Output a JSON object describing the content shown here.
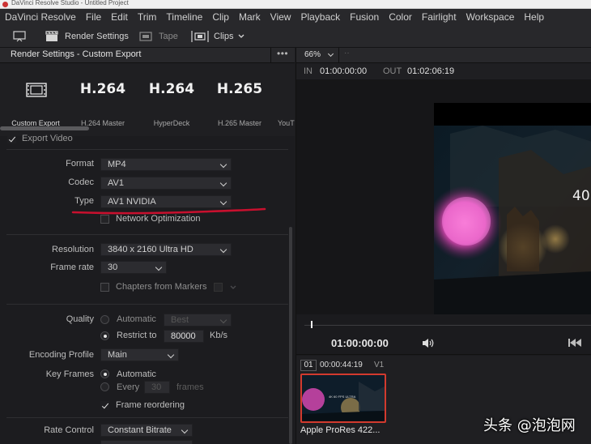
{
  "window": {
    "title": "DaVinci Resolve Studio - Untitled Project"
  },
  "menu": [
    "DaVinci Resolve",
    "File",
    "Edit",
    "Trim",
    "Timeline",
    "Clip",
    "Mark",
    "View",
    "Playback",
    "Fusion",
    "Color",
    "Fairlight",
    "Workspace",
    "Help"
  ],
  "toolbar": {
    "render_settings": "Render Settings",
    "tape": "Tape",
    "clips": "Clips"
  },
  "render_panel": {
    "title": "Render Settings - Custom Export",
    "more": "•••",
    "presets": [
      {
        "big": "",
        "sub": "Custom Export"
      },
      {
        "big": "H.264",
        "sub": "H.264 Master"
      },
      {
        "big": "H.264",
        "sub": "HyperDeck"
      },
      {
        "big": "H.265",
        "sub": "H.265 Master"
      },
      {
        "big": "",
        "sub": "YouT"
      }
    ],
    "export_video": "Export Video",
    "format": {
      "label": "Format",
      "value": "MP4"
    },
    "codec": {
      "label": "Codec",
      "value": "AV1"
    },
    "type": {
      "label": "Type",
      "value": "AV1 NVIDIA"
    },
    "network_optimization": "Network Optimization",
    "resolution": {
      "label": "Resolution",
      "value": "3840 x 2160 Ultra HD"
    },
    "frame_rate": {
      "label": "Frame rate",
      "value": "30"
    },
    "chapters_from_markers": "Chapters from Markers",
    "quality": {
      "label": "Quality",
      "automatic": "Automatic",
      "best": "Best",
      "restrict_to": "Restrict to",
      "value": "80000",
      "unit": "Kb/s"
    },
    "encoding_profile": {
      "label": "Encoding Profile",
      "value": "Main"
    },
    "key_frames": {
      "label": "Key Frames",
      "automatic": "Automatic",
      "every": "Every",
      "value": "30",
      "unit": "frames"
    },
    "frame_reordering": "Frame reordering",
    "rate_control": {
      "label": "Rate Control",
      "value": "Constant Bitrate"
    }
  },
  "viewer": {
    "zoom": "66%",
    "zoom_more": "··",
    "in_label": "IN",
    "in_tc": "01:00:00:00",
    "out_label": "OUT",
    "out_tc": "01:02:06:19",
    "video_text": "40",
    "timecode": "01:00:00:00"
  },
  "clips": {
    "number": "01",
    "timecode": "00:00:44:19",
    "track": "V1",
    "thumb_text": "4K 60 FPS ULTRA",
    "name": "Apple ProRes 422..."
  },
  "watermark": "头条 @泡泡网",
  "colors": {
    "accent_red": "#d23a2e",
    "annotation_red": "#c8102e",
    "panel_bg": "#1c1c1f"
  }
}
